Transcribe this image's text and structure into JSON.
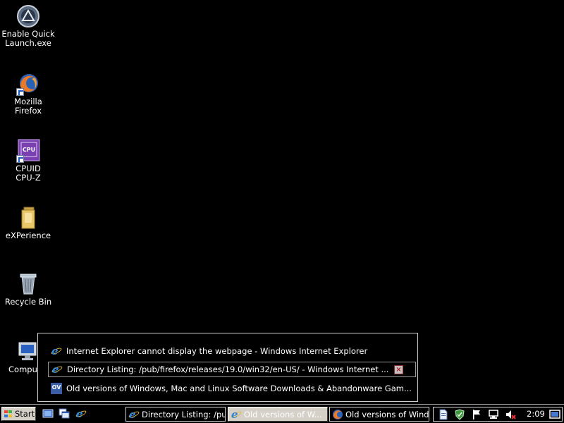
{
  "desktop": {
    "icons": [
      {
        "label_line1": "Enable Quick",
        "label_line2": "Launch.exe",
        "icon": "app-exe-icon"
      },
      {
        "label_line1": "Mozilla",
        "label_line2": "Firefox",
        "icon": "firefox-icon"
      },
      {
        "label_line1": "CPUID",
        "label_line2": "CPU-Z",
        "icon": "cpuz-icon"
      },
      {
        "label_line1": "eXPerience",
        "label_line2": "",
        "icon": "folder-icon"
      },
      {
        "label_line1": "Recycle Bin",
        "label_line2": "",
        "icon": "recycle-bin-icon"
      },
      {
        "label_line1": "Compu",
        "label_line2": "",
        "icon": "computer-icon"
      }
    ]
  },
  "group_popup": {
    "items": [
      {
        "label": "Internet Explorer cannot display the webpage - Windows Internet Explorer",
        "icon": "ie-icon"
      },
      {
        "label": "Directory Listing: /pub/firefox/releases/19.0/win32/en-US/ - Windows Internet ...",
        "icon": "ie-icon",
        "close": "×"
      },
      {
        "label": "Old versions of Windows, Mac and Linux Software Downloads & Abandonware Gam...",
        "icon": "oldversion-icon",
        "icon_text": "OV"
      }
    ]
  },
  "taskbar": {
    "start_label": "Start",
    "tasks": [
      {
        "label": "Directory Listing: /pub...",
        "icon": "ie-icon"
      },
      {
        "label": "Old versions of W...",
        "icon": "ie-icon"
      },
      {
        "label": "Old versions of Windo...",
        "icon": "firefox-icon"
      }
    ],
    "clock": "2:09"
  },
  "colors": {
    "background": "#000000",
    "taskbar_button": "#d4d0c8",
    "ie_blue": "#2f86d8"
  }
}
